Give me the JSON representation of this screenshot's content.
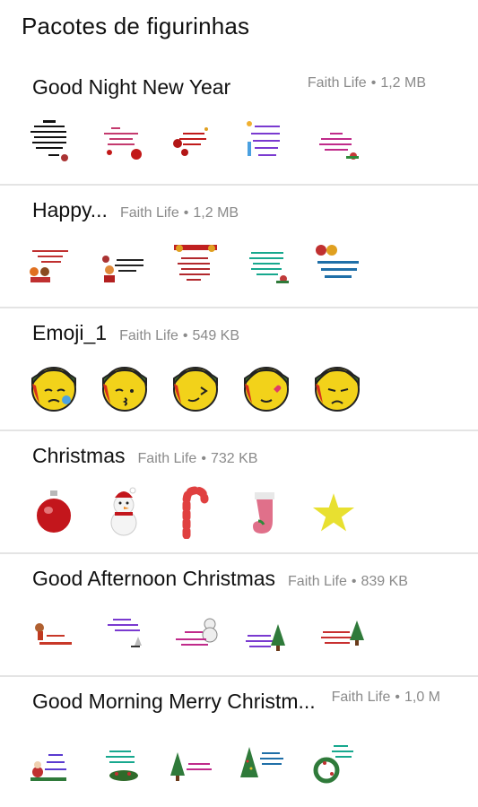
{
  "header": {
    "title": "Pacotes de figurinhas"
  },
  "packs": [
    {
      "name": "Good Night New Year",
      "publisher": "Faith Life",
      "size": "1,2 MB",
      "stickers": [
        "greeting-card",
        "greeting-card",
        "greeting-card",
        "greeting-card",
        "greeting-card"
      ]
    },
    {
      "name": "Happy...",
      "publisher": "Faith Life",
      "size": "1,2 MB",
      "stickers": [
        "greeting-card",
        "greeting-card",
        "greeting-card",
        "greeting-card",
        "greeting-card"
      ]
    },
    {
      "name": "Emoji_1",
      "publisher": "Faith Life",
      "size": "549 KB",
      "stickers": [
        "crying-face",
        "kissing-face",
        "grimacing-face",
        "heart-eye-face",
        "worried-face"
      ]
    },
    {
      "name": "Christmas",
      "publisher": "Faith Life",
      "size": "732 KB",
      "stickers": [
        "ornament-ball",
        "snowman",
        "candy-cane",
        "stocking",
        "star"
      ]
    },
    {
      "name": "Good Afternoon Christmas",
      "publisher": "Faith Life",
      "size": "839 KB",
      "stickers": [
        "greeting-card",
        "greeting-card",
        "greeting-card",
        "greeting-card",
        "greeting-card"
      ]
    },
    {
      "name": "Good Morning Merry Christm...",
      "publisher": "Faith Life",
      "size": "1,0 M",
      "stickers": [
        "greeting-card",
        "greeting-card",
        "greeting-card",
        "greeting-card",
        "greeting-card"
      ]
    }
  ],
  "meta_separator": "•"
}
